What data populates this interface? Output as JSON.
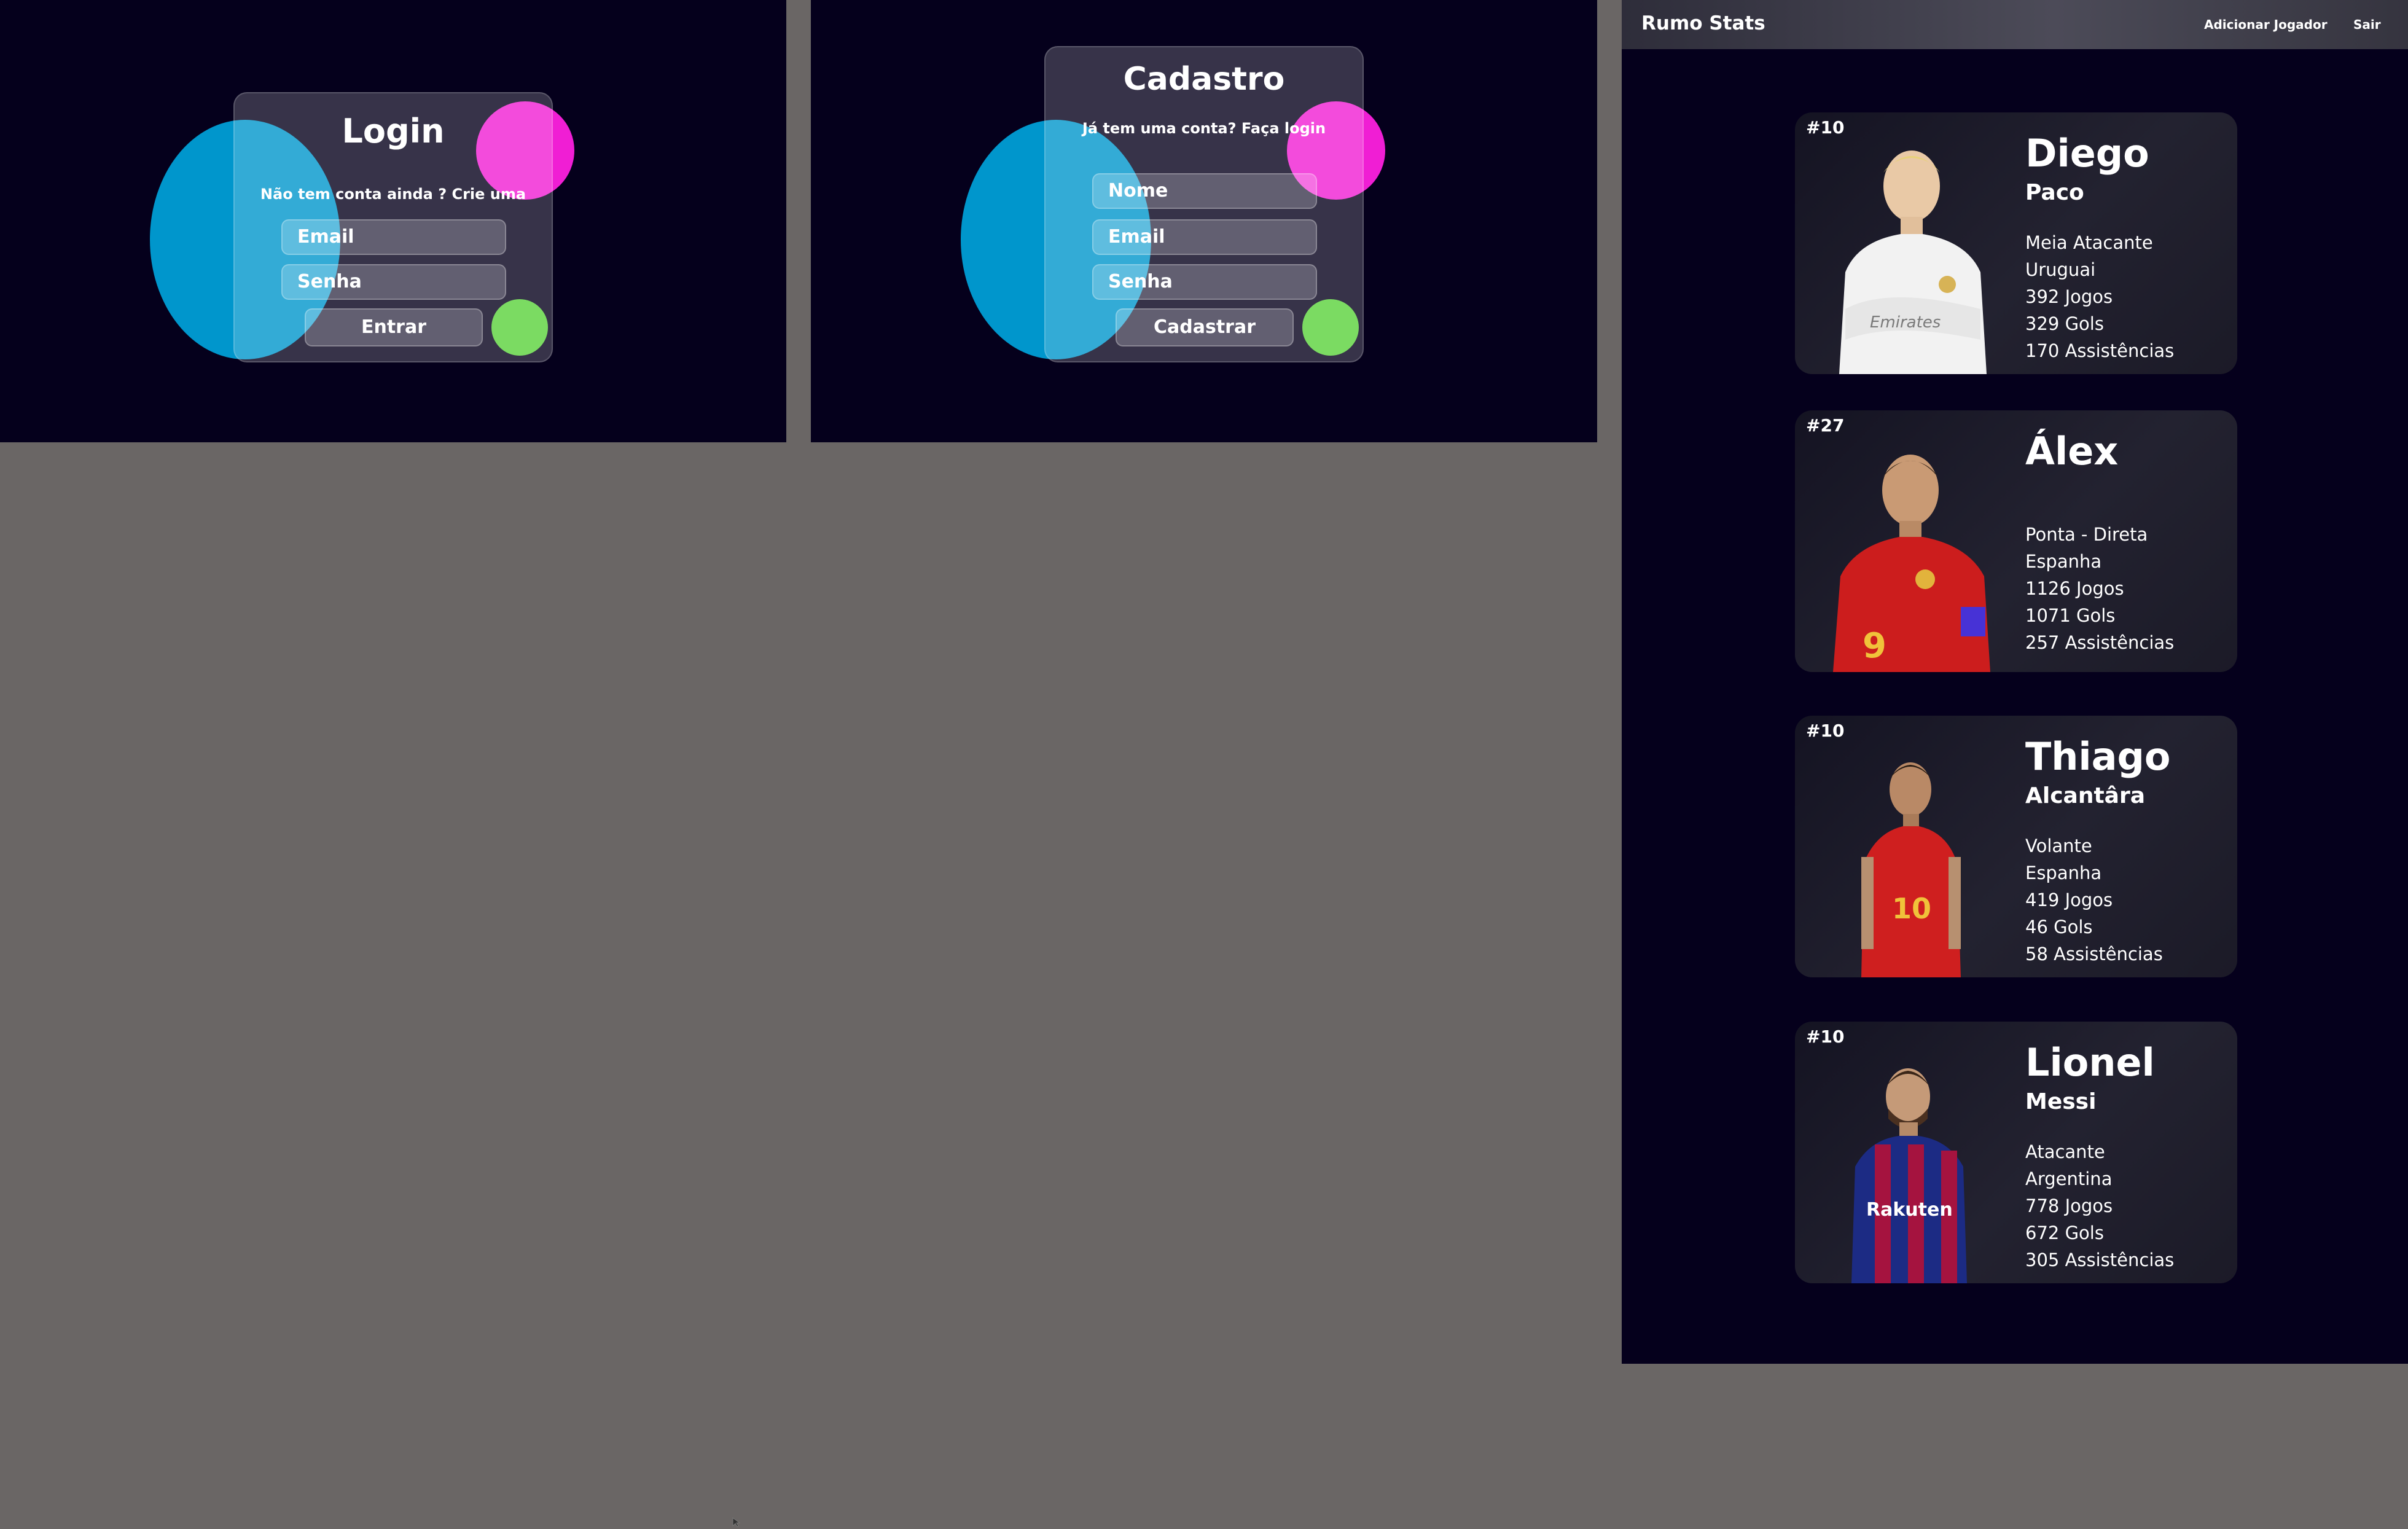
{
  "login": {
    "title": "Login",
    "subtitle": "Não tem conta ainda ? Crie uma",
    "email_placeholder": "Email",
    "password_placeholder": "Senha",
    "submit_label": "Entrar"
  },
  "signup": {
    "title": "Cadastro",
    "subtitle": "Já tem uma conta? Faça login",
    "name_placeholder": "Nome",
    "email_placeholder": "Email",
    "password_placeholder": "Senha",
    "submit_label": "Cadastrar"
  },
  "stats_page": {
    "brand": "Rumo Stats",
    "nav": {
      "add_player": "Adicionar Jogador",
      "logout": "Sair"
    },
    "players": [
      {
        "number": "#10",
        "first_name": "Diego",
        "last_name": "Paco",
        "position": "Meia Atacante",
        "country": "Uruguai",
        "games": "392 Jogos",
        "goals": "329 Gols",
        "assists": "170 Assistências",
        "kit": "white-kit"
      },
      {
        "number": "#27",
        "first_name": "Álex",
        "last_name": "",
        "position": "Ponta - Direta",
        "country": "Espanha",
        "games": "1126 Jogos",
        "goals": "1071 Gols",
        "assists": "257 Assistências",
        "kit": "spain-red-kit"
      },
      {
        "number": "#10",
        "first_name": "Thiago",
        "last_name": "Alcantâra",
        "position": "Volante",
        "country": "Espanha",
        "games": "419 Jogos",
        "goals": "46 Gols",
        "assists": "58 Assistências",
        "kit": "spain-red-kit"
      },
      {
        "number": "#10",
        "first_name": "Lionel",
        "last_name": "Messi",
        "position": "Atacante",
        "country": "Argentina",
        "games": "778 Jogos",
        "goals": "672 Gols",
        "assists": "305 Assistências",
        "kit": "barcelona-kit",
        "shirt_text": "Rakuten"
      }
    ]
  },
  "colors": {
    "page_bg": "#05001c",
    "gutter": "#6a6665",
    "blob_blue": "#0096cc",
    "blob_pink": "#f01ed4",
    "blob_green": "#5bd23b"
  }
}
